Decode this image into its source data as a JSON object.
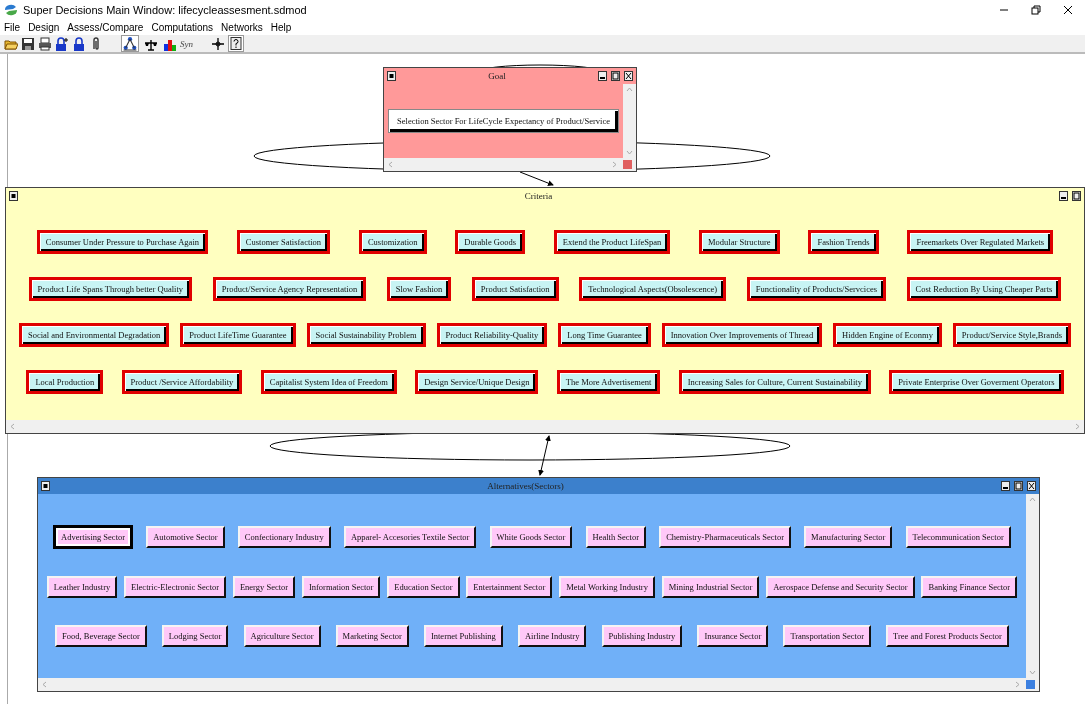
{
  "window": {
    "title": "Super Decisions Main Window: lifecycleassesment.sdmod"
  },
  "menu": [
    "File",
    "Design",
    "Assess/Compare",
    "Computations",
    "Networks",
    "Help"
  ],
  "toolbar": {
    "syn_label": "Syn"
  },
  "clusters": [
    {
      "kind": "goal",
      "title": "Goal",
      "color": "#ff9999",
      "closable": true,
      "vscroll": true,
      "nodes": [
        {
          "label": "Selection Sector For LifeCycle Expectancy of Product/Service",
          "selected": false
        }
      ]
    },
    {
      "kind": "criteria",
      "title": "Criteria",
      "color": "#ffffc0",
      "closable": false,
      "vscroll": false,
      "nodes": [
        {
          "label": "Consumer Under Pressure to Purchase Again",
          "selected": false
        },
        {
          "label": "Customer Satisfaction",
          "selected": false
        },
        {
          "label": "Customization",
          "selected": false
        },
        {
          "label": "Durable Goods",
          "selected": false
        },
        {
          "label": "Extend the Product LifeSpan",
          "selected": false
        },
        {
          "label": "Modular Structure",
          "selected": false
        },
        {
          "label": "Fashion Trends",
          "selected": false
        },
        {
          "label": "Freemarkets Over Regulated Markets",
          "selected": false
        },
        {
          "label": "Product Life Spans Through better Quality",
          "selected": false
        },
        {
          "label": "Product/Service Agency Representation",
          "selected": false
        },
        {
          "label": "Slow Fashion",
          "selected": false
        },
        {
          "label": "Product Satisfaction",
          "selected": false
        },
        {
          "label": "Technological Aspects(Obsolescence)",
          "selected": false
        },
        {
          "label": "Functionality of Products/Servcices",
          "selected": false
        },
        {
          "label": "Cost Reduction By Using Cheaper Parts",
          "selected": false
        },
        {
          "label": "Social and Environmental Degradation",
          "selected": false
        },
        {
          "label": "Product LifeTime  Guarantee",
          "selected": false
        },
        {
          "label": "Social Sustainability Problem",
          "selected": false
        },
        {
          "label": "Product Reliability-Quality",
          "selected": false
        },
        {
          "label": "Long Time Guarantee",
          "selected": false
        },
        {
          "label": "Innovation Over Improvements of Thread",
          "selected": false
        },
        {
          "label": "Hidden Engine of Econmy",
          "selected": false
        },
        {
          "label": "Product/Service Style,Brands",
          "selected": false
        },
        {
          "label": "Local Production",
          "selected": false
        },
        {
          "label": "Product /Service Affordability",
          "selected": false
        },
        {
          "label": "Capitalist System Idea of Freedom",
          "selected": false
        },
        {
          "label": "Design Service/Unique Design",
          "selected": false
        },
        {
          "label": "The More Advertisement",
          "selected": false
        },
        {
          "label": "Increasing Sales for Culture, Current Sustainability",
          "selected": false
        },
        {
          "label": "Private Enterprise Over Goverment Operators",
          "selected": false
        }
      ]
    },
    {
      "kind": "alternatives",
      "title": "Alternatives(Sectors)",
      "color": "#70b0f8",
      "closable": true,
      "vscroll": true,
      "nodes": [
        {
          "label": "Advertising Sector",
          "selected": true
        },
        {
          "label": "Automotive Sector",
          "selected": false
        },
        {
          "label": "Confectionary Industry",
          "selected": false
        },
        {
          "label": "Apparel- Accesories Textile Sector",
          "selected": false
        },
        {
          "label": "White Goods Sector",
          "selected": false
        },
        {
          "label": "Health  Sector",
          "selected": false
        },
        {
          "label": "Chemistry-Pharmaceuticals Sector",
          "selected": false
        },
        {
          "label": "Manufacturing Sector",
          "selected": false
        },
        {
          "label": "Telecommunication Sector",
          "selected": false
        },
        {
          "label": "Leather Industry",
          "selected": false
        },
        {
          "label": "Electric-Electronic Sector",
          "selected": false
        },
        {
          "label": "Energy Sector",
          "selected": false
        },
        {
          "label": "Information Sector",
          "selected": false
        },
        {
          "label": "Education Sector",
          "selected": false
        },
        {
          "label": "Entertainment Sector",
          "selected": false
        },
        {
          "label": "Metal Working Industry",
          "selected": false
        },
        {
          "label": "Mining Industrial Sector",
          "selected": false
        },
        {
          "label": "Aerospace Defense and Security Sector",
          "selected": false
        },
        {
          "label": "Banking Finance Sector",
          "selected": false
        },
        {
          "label": "Food, Beverage Sector",
          "selected": false
        },
        {
          "label": "Lodging Sector",
          "selected": false
        },
        {
          "label": "Agriculture Sector",
          "selected": false
        },
        {
          "label": "Marketing Sector",
          "selected": false
        },
        {
          "label": "Internet Publishing",
          "selected": false
        },
        {
          "label": "Airline Industry",
          "selected": false
        },
        {
          "label": "Publishing Industry",
          "selected": false
        },
        {
          "label": "Insurance Sector",
          "selected": false
        },
        {
          "label": "Transportation Sector",
          "selected": false
        },
        {
          "label": "Tree and Forest Products Sector",
          "selected": false
        }
      ]
    }
  ]
}
